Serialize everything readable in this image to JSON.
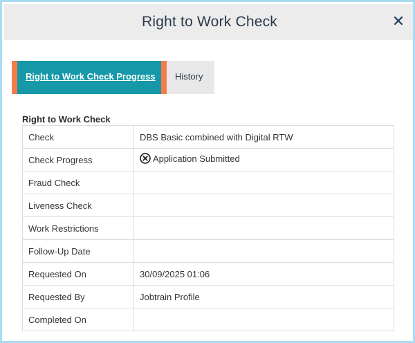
{
  "dialog": {
    "title": "Right to Work Check",
    "close_symbol": "✕"
  },
  "tabs": [
    {
      "label": "Right to Work Check Progress",
      "active": true
    },
    {
      "label": "History",
      "active": false
    }
  ],
  "section": {
    "title": "Right to Work Check"
  },
  "table": {
    "rows": [
      {
        "label": "Check",
        "value": "DBS Basic combined with Digital RTW"
      },
      {
        "label": "Check Progress",
        "value": "Application Submitted",
        "icon": "circle-x-icon"
      },
      {
        "label": "Fraud Check",
        "value": ""
      },
      {
        "label": "Liveness Check",
        "value": ""
      },
      {
        "label": "Work Restrictions",
        "value": ""
      },
      {
        "label": "Follow-Up Date",
        "value": ""
      },
      {
        "label": "Requested On",
        "value": "30/09/2025 01:06"
      },
      {
        "label": "Requested By",
        "value": "Jobtrain Profile"
      },
      {
        "label": "Completed On",
        "value": ""
      }
    ]
  },
  "colors": {
    "accent_teal": "#1698a8",
    "accent_orange": "#f47c4a",
    "frame_border": "#a9dcf2"
  }
}
